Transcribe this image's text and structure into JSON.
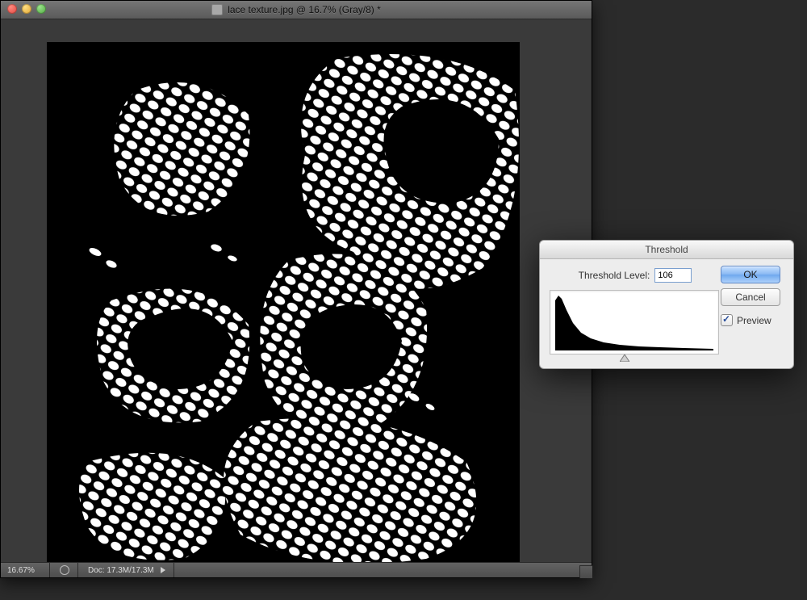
{
  "document_window": {
    "title": "lace texture.jpg @ 16.7% (Gray/8) *",
    "zoom": "16.67%",
    "doc_info_label": "Doc: 17.3M/17.3M"
  },
  "threshold_dialog": {
    "title": "Threshold",
    "level_label": "Threshold Level:",
    "level_value": "106",
    "ok_label": "OK",
    "cancel_label": "Cancel",
    "preview_label": "Preview",
    "preview_checked": true
  }
}
